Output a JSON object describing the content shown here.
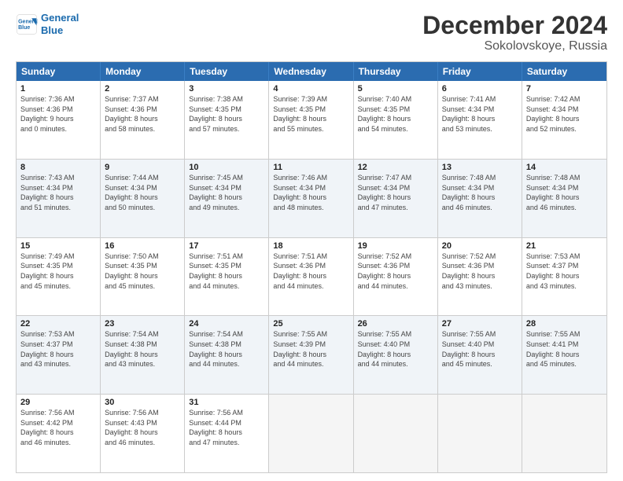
{
  "logo": {
    "line1": "General",
    "line2": "Blue"
  },
  "title": "December 2024",
  "location": "Sokolovskoye, Russia",
  "header_days": [
    "Sunday",
    "Monday",
    "Tuesday",
    "Wednesday",
    "Thursday",
    "Friday",
    "Saturday"
  ],
  "rows": [
    [
      {
        "day": "1",
        "info": "Sunrise: 7:36 AM\nSunset: 4:36 PM\nDaylight: 9 hours\nand 0 minutes."
      },
      {
        "day": "2",
        "info": "Sunrise: 7:37 AM\nSunset: 4:36 PM\nDaylight: 8 hours\nand 58 minutes."
      },
      {
        "day": "3",
        "info": "Sunrise: 7:38 AM\nSunset: 4:35 PM\nDaylight: 8 hours\nand 57 minutes."
      },
      {
        "day": "4",
        "info": "Sunrise: 7:39 AM\nSunset: 4:35 PM\nDaylight: 8 hours\nand 55 minutes."
      },
      {
        "day": "5",
        "info": "Sunrise: 7:40 AM\nSunset: 4:35 PM\nDaylight: 8 hours\nand 54 minutes."
      },
      {
        "day": "6",
        "info": "Sunrise: 7:41 AM\nSunset: 4:34 PM\nDaylight: 8 hours\nand 53 minutes."
      },
      {
        "day": "7",
        "info": "Sunrise: 7:42 AM\nSunset: 4:34 PM\nDaylight: 8 hours\nand 52 minutes."
      }
    ],
    [
      {
        "day": "8",
        "info": "Sunrise: 7:43 AM\nSunset: 4:34 PM\nDaylight: 8 hours\nand 51 minutes."
      },
      {
        "day": "9",
        "info": "Sunrise: 7:44 AM\nSunset: 4:34 PM\nDaylight: 8 hours\nand 50 minutes."
      },
      {
        "day": "10",
        "info": "Sunrise: 7:45 AM\nSunset: 4:34 PM\nDaylight: 8 hours\nand 49 minutes."
      },
      {
        "day": "11",
        "info": "Sunrise: 7:46 AM\nSunset: 4:34 PM\nDaylight: 8 hours\nand 48 minutes."
      },
      {
        "day": "12",
        "info": "Sunrise: 7:47 AM\nSunset: 4:34 PM\nDaylight: 8 hours\nand 47 minutes."
      },
      {
        "day": "13",
        "info": "Sunrise: 7:48 AM\nSunset: 4:34 PM\nDaylight: 8 hours\nand 46 minutes."
      },
      {
        "day": "14",
        "info": "Sunrise: 7:48 AM\nSunset: 4:34 PM\nDaylight: 8 hours\nand 46 minutes."
      }
    ],
    [
      {
        "day": "15",
        "info": "Sunrise: 7:49 AM\nSunset: 4:35 PM\nDaylight: 8 hours\nand 45 minutes."
      },
      {
        "day": "16",
        "info": "Sunrise: 7:50 AM\nSunset: 4:35 PM\nDaylight: 8 hours\nand 45 minutes."
      },
      {
        "day": "17",
        "info": "Sunrise: 7:51 AM\nSunset: 4:35 PM\nDaylight: 8 hours\nand 44 minutes."
      },
      {
        "day": "18",
        "info": "Sunrise: 7:51 AM\nSunset: 4:36 PM\nDaylight: 8 hours\nand 44 minutes."
      },
      {
        "day": "19",
        "info": "Sunrise: 7:52 AM\nSunset: 4:36 PM\nDaylight: 8 hours\nand 44 minutes."
      },
      {
        "day": "20",
        "info": "Sunrise: 7:52 AM\nSunset: 4:36 PM\nDaylight: 8 hours\nand 43 minutes."
      },
      {
        "day": "21",
        "info": "Sunrise: 7:53 AM\nSunset: 4:37 PM\nDaylight: 8 hours\nand 43 minutes."
      }
    ],
    [
      {
        "day": "22",
        "info": "Sunrise: 7:53 AM\nSunset: 4:37 PM\nDaylight: 8 hours\nand 43 minutes."
      },
      {
        "day": "23",
        "info": "Sunrise: 7:54 AM\nSunset: 4:38 PM\nDaylight: 8 hours\nand 43 minutes."
      },
      {
        "day": "24",
        "info": "Sunrise: 7:54 AM\nSunset: 4:38 PM\nDaylight: 8 hours\nand 44 minutes."
      },
      {
        "day": "25",
        "info": "Sunrise: 7:55 AM\nSunset: 4:39 PM\nDaylight: 8 hours\nand 44 minutes."
      },
      {
        "day": "26",
        "info": "Sunrise: 7:55 AM\nSunset: 4:40 PM\nDaylight: 8 hours\nand 44 minutes."
      },
      {
        "day": "27",
        "info": "Sunrise: 7:55 AM\nSunset: 4:40 PM\nDaylight: 8 hours\nand 45 minutes."
      },
      {
        "day": "28",
        "info": "Sunrise: 7:55 AM\nSunset: 4:41 PM\nDaylight: 8 hours\nand 45 minutes."
      }
    ],
    [
      {
        "day": "29",
        "info": "Sunrise: 7:56 AM\nSunset: 4:42 PM\nDaylight: 8 hours\nand 46 minutes."
      },
      {
        "day": "30",
        "info": "Sunrise: 7:56 AM\nSunset: 4:43 PM\nDaylight: 8 hours\nand 46 minutes."
      },
      {
        "day": "31",
        "info": "Sunrise: 7:56 AM\nSunset: 4:44 PM\nDaylight: 8 hours\nand 47 minutes."
      },
      {
        "day": "",
        "info": ""
      },
      {
        "day": "",
        "info": ""
      },
      {
        "day": "",
        "info": ""
      },
      {
        "day": "",
        "info": ""
      }
    ]
  ]
}
